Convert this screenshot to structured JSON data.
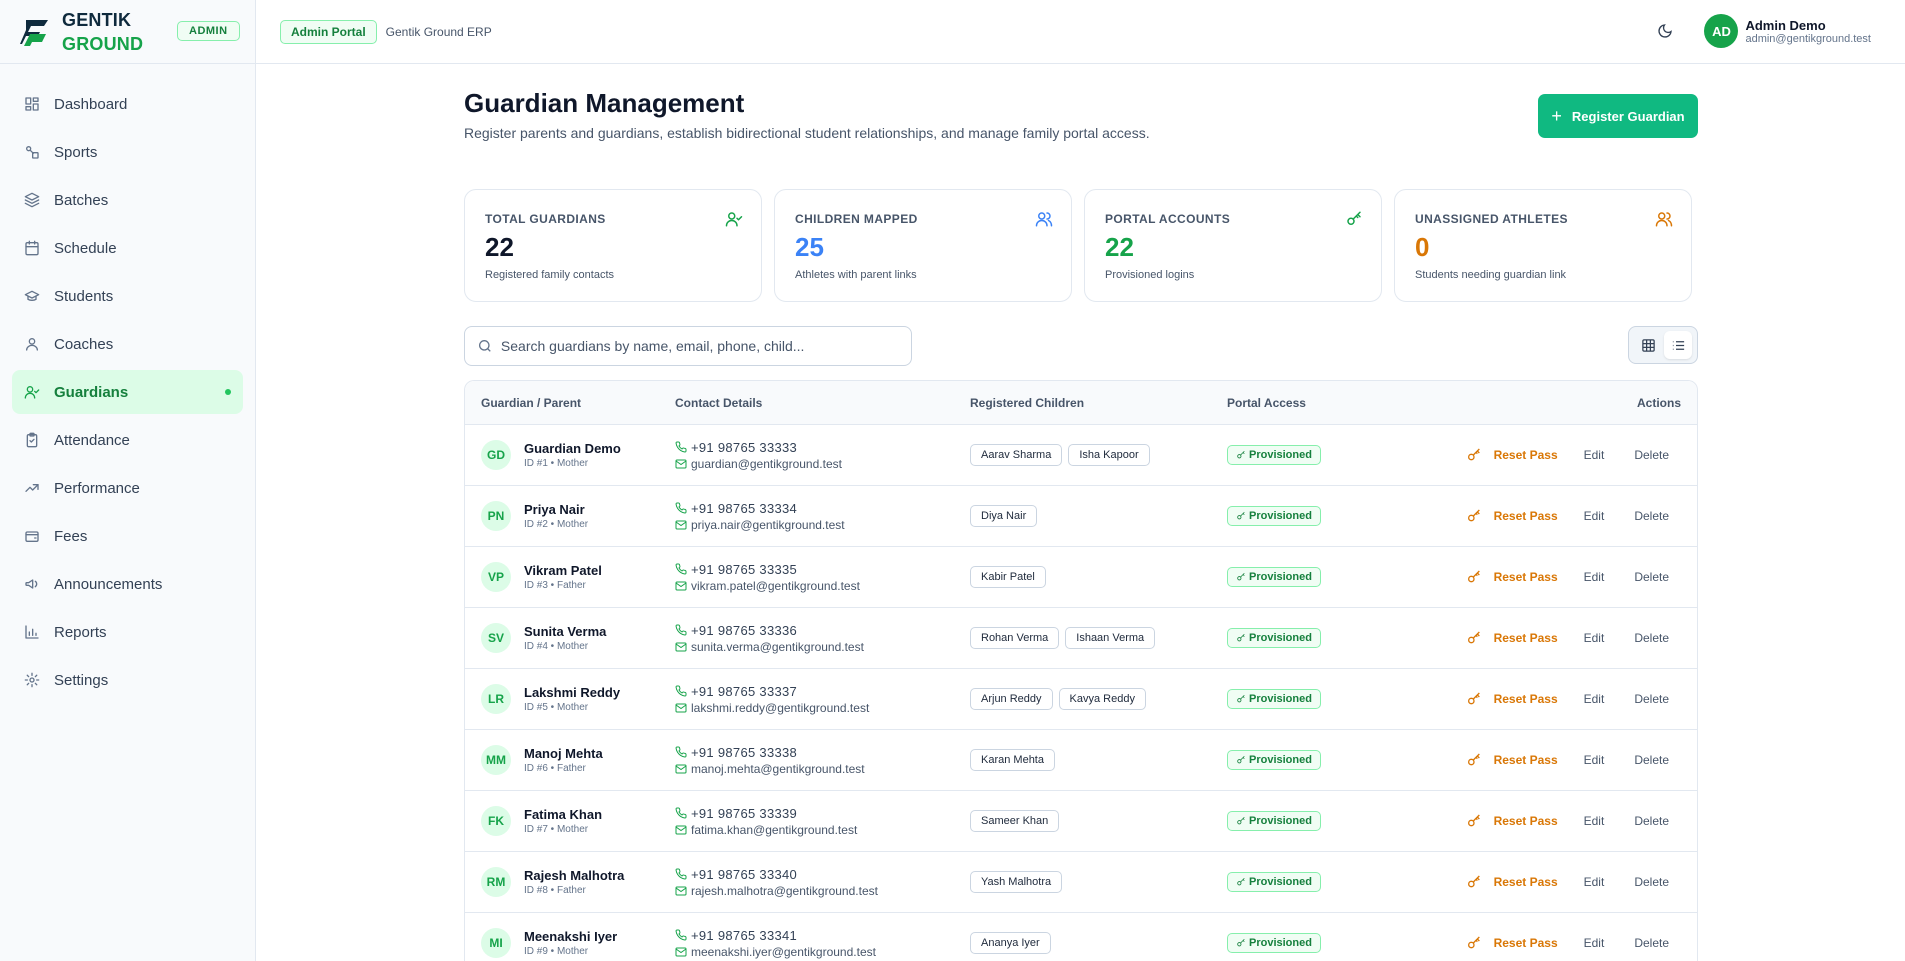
{
  "brand": {
    "line1": "GENTIK",
    "line2": "GROUND",
    "role_badge": "ADMIN"
  },
  "nav": [
    {
      "label": "Dashboard",
      "icon": "dashboard-icon"
    },
    {
      "label": "Sports",
      "icon": "sports-icon"
    },
    {
      "label": "Batches",
      "icon": "layers-icon"
    },
    {
      "label": "Schedule",
      "icon": "calendar-icon"
    },
    {
      "label": "Students",
      "icon": "graduation-cap-icon"
    },
    {
      "label": "Coaches",
      "icon": "user-icon"
    },
    {
      "label": "Guardians",
      "icon": "user-check-icon",
      "active": true
    },
    {
      "label": "Attendance",
      "icon": "clipboard-icon"
    },
    {
      "label": "Performance",
      "icon": "trend-icon"
    },
    {
      "label": "Fees",
      "icon": "wallet-icon"
    },
    {
      "label": "Announcements",
      "icon": "megaphone-icon"
    },
    {
      "label": "Reports",
      "icon": "bar-chart-icon"
    },
    {
      "label": "Settings",
      "icon": "gear-icon"
    }
  ],
  "topbar": {
    "portal_badge": "Admin Portal",
    "erp_label": "Gentik Ground ERP"
  },
  "user": {
    "initials": "AD",
    "name": "Admin Demo",
    "email": "admin@gentikground.test"
  },
  "page": {
    "title": "Guardian Management",
    "subtitle": "Register parents and guardians, establish bidirectional student relationships, and manage family portal access.",
    "register_label": "Register Guardian"
  },
  "stats": [
    {
      "label": "TOTAL GUARDIANS",
      "value": "22",
      "desc": "Registered family contacts",
      "color": "#0f172a",
      "icon_color": "#16a34a"
    },
    {
      "label": "CHILDREN MAPPED",
      "value": "25",
      "desc": "Athletes with parent links",
      "color": "#3b82f6",
      "icon_color": "#3b82f6"
    },
    {
      "label": "PORTAL ACCOUNTS",
      "value": "22",
      "desc": "Provisioned logins",
      "color": "#16a34a",
      "icon_color": "#16a34a"
    },
    {
      "label": "UNASSIGNED ATHLETES",
      "value": "0",
      "desc": "Students needing guardian link",
      "color": "#d97706",
      "icon_color": "#d97706"
    }
  ],
  "search": {
    "placeholder": "Search guardians by name, email, phone, child..."
  },
  "table": {
    "headers": {
      "guardian": "Guardian / Parent",
      "contact": "Contact Details",
      "children": "Registered Children",
      "portal": "Portal Access",
      "actions": "Actions"
    },
    "action_labels": {
      "reset": "Reset Pass",
      "edit": "Edit",
      "delete": "Delete"
    },
    "rows": [
      {
        "initials": "GD",
        "name": "Guardian Demo",
        "meta": "ID #1  • Mother",
        "phone": "+91  98765  33333",
        "email": "guardian@gentikground.test",
        "children": [
          "Aarav Sharma",
          "Isha Kapoor"
        ],
        "portal": "Provisioned"
      },
      {
        "initials": "PN",
        "name": "Priya Nair",
        "meta": "ID #2  • Mother",
        "phone": "+91  98765  33334",
        "email": "priya.nair@gentikground.test",
        "children": [
          "Diya Nair"
        ],
        "portal": "Provisioned"
      },
      {
        "initials": "VP",
        "name": "Vikram Patel",
        "meta": "ID #3  • Father",
        "phone": "+91  98765  33335",
        "email": "vikram.patel@gentikground.test",
        "children": [
          "Kabir Patel"
        ],
        "portal": "Provisioned"
      },
      {
        "initials": "SV",
        "name": "Sunita Verma",
        "meta": "ID #4  • Mother",
        "phone": "+91  98765  33336",
        "email": "sunita.verma@gentikground.test",
        "children": [
          "Rohan Verma",
          "Ishaan Verma"
        ],
        "portal": "Provisioned"
      },
      {
        "initials": "LR",
        "name": "Lakshmi Reddy",
        "meta": "ID #5  • Mother",
        "phone": "+91  98765  33337",
        "email": "lakshmi.reddy@gentikground.test",
        "children": [
          "Arjun Reddy",
          "Kavya Reddy"
        ],
        "portal": "Provisioned"
      },
      {
        "initials": "MM",
        "name": "Manoj Mehta",
        "meta": "ID #6  • Father",
        "phone": "+91  98765  33338",
        "email": "manoj.mehta@gentikground.test",
        "children": [
          "Karan Mehta"
        ],
        "portal": "Provisioned"
      },
      {
        "initials": "FK",
        "name": "Fatima Khan",
        "meta": "ID #7  • Mother",
        "phone": "+91  98765  33339",
        "email": "fatima.khan@gentikground.test",
        "children": [
          "Sameer Khan"
        ],
        "portal": "Provisioned"
      },
      {
        "initials": "RM",
        "name": "Rajesh Malhotra",
        "meta": "ID #8  • Father",
        "phone": "+91  98765  33340",
        "email": "rajesh.malhotra@gentikground.test",
        "children": [
          "Yash Malhotra"
        ],
        "portal": "Provisioned"
      },
      {
        "initials": "MI",
        "name": "Meenakshi Iyer",
        "meta": "ID #9  • Mother",
        "phone": "+91  98765  33341",
        "email": "meenakshi.iyer@gentikground.test",
        "children": [
          "Ananya Iyer"
        ],
        "portal": "Provisioned"
      }
    ]
  }
}
